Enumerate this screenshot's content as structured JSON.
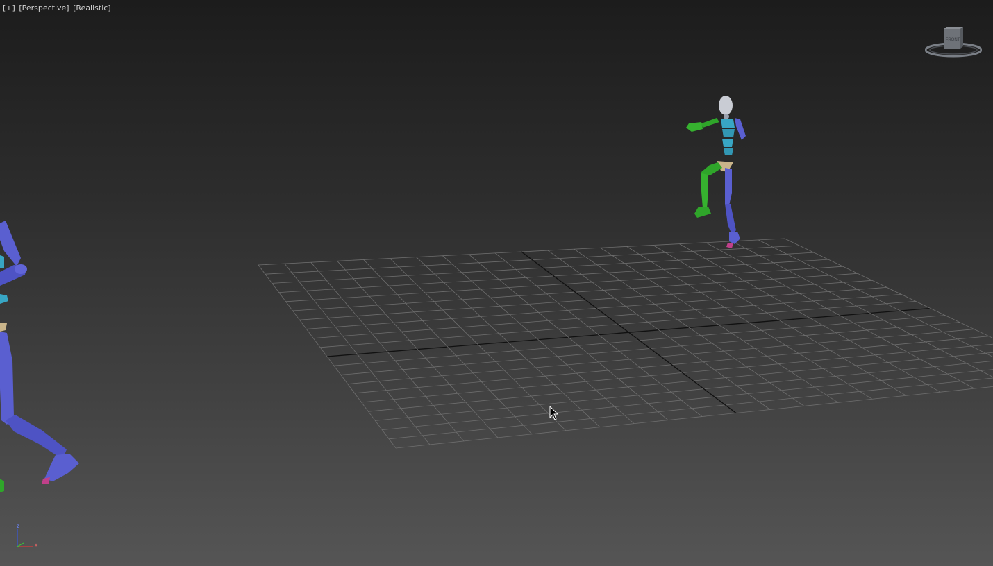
{
  "viewport": {
    "menus": [
      "[+]",
      "[Perspective]",
      "[Realistic]"
    ],
    "separator": " ",
    "background": {
      "top": "#1c1c1c",
      "bottom": "#555555"
    }
  },
  "scene": {
    "grid": {
      "rows": 20,
      "cols": 20,
      "line_color": "#6e6e6e",
      "axis_color": "#111111"
    },
    "bone_colors": {
      "blue": "#5a5fd0",
      "green": "#2fa52a",
      "cyan": "#38a6c4",
      "head": "#c9ccd4",
      "pelvis": "#c9b48a",
      "pink": "#c0408a"
    }
  },
  "viewcube": {
    "face_label": "FRONT"
  },
  "axis_tripod": {
    "z_label": "z",
    "x_label": "x",
    "y_label": "y"
  },
  "cursor": {
    "icon": "arrow-pointer"
  }
}
